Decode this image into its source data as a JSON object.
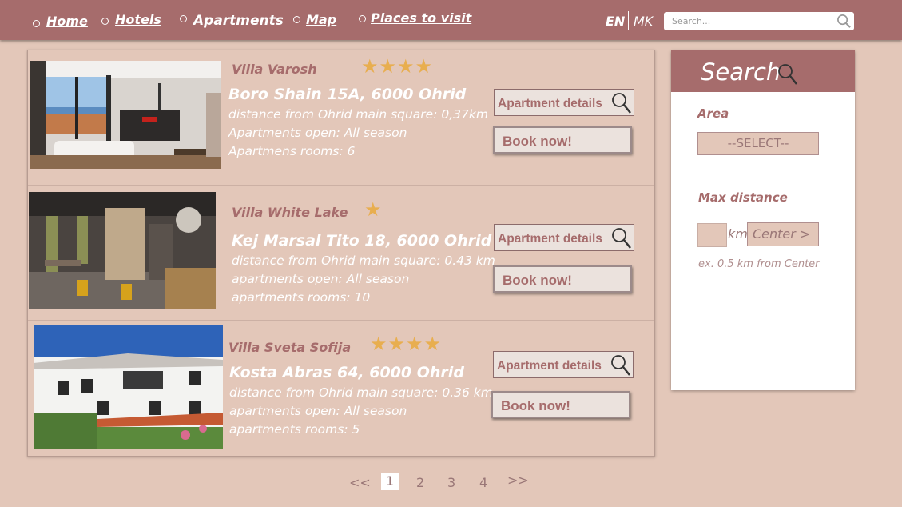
{
  "nav": {
    "items": [
      {
        "label": "Home"
      },
      {
        "label": "Hotels"
      },
      {
        "label": "Apartments"
      },
      {
        "label": "Map"
      },
      {
        "label": "Places to visit"
      }
    ],
    "lang_en": "EN",
    "lang_mk": "MK",
    "search_placeholder": "Search..."
  },
  "listings": [
    {
      "name": "Villa Varosh",
      "stars": 4,
      "stars_text": "★★★★",
      "address": "Boro Shain 15A, 6000 Ohrid",
      "distance": "distance from Ohrid main square: 0,37km",
      "open": "Apartments open: All season",
      "rooms": "Apartmens rooms: 6",
      "details_label": "Apartment details",
      "book_label": "Book now!"
    },
    {
      "name": "Villa White Lake",
      "stars": 1,
      "stars_text": "★",
      "address": "Kej Marsal Tito 18, 6000 Ohrid",
      "distance": "distance from Ohrid main square: 0.43 km",
      "open": "apartments open: All season",
      "rooms": "apartments rooms: 10",
      "details_label": "Apartment details",
      "book_label": "Book now!"
    },
    {
      "name": "Villa Sveta Sofija",
      "stars": 4,
      "stars_text": "★★★★",
      "address": "Kosta Abras 64, 6000 Ohrid",
      "distance": "distance from Ohrid main square: 0.36 km",
      "open": "apartments open: All season",
      "rooms": "apartments rooms: 5",
      "details_label": "Apartment details",
      "book_label": "Book now!"
    }
  ],
  "pagination": {
    "prev": "<<",
    "pages": [
      "1",
      "2",
      "3",
      "4"
    ],
    "current": "1",
    "next": ">>"
  },
  "search_panel": {
    "title": "Search",
    "area_label": "Area",
    "area_value": "--SELECT--",
    "max_distance_label": "Max distance",
    "km_value": "",
    "km_unit": "km",
    "center_label": "Center   >",
    "hint": "ex. 0.5 km from Center"
  },
  "colors": {
    "background": "#e3c7b9",
    "accent": "#a66c6c",
    "star": "#e8ae4f"
  }
}
